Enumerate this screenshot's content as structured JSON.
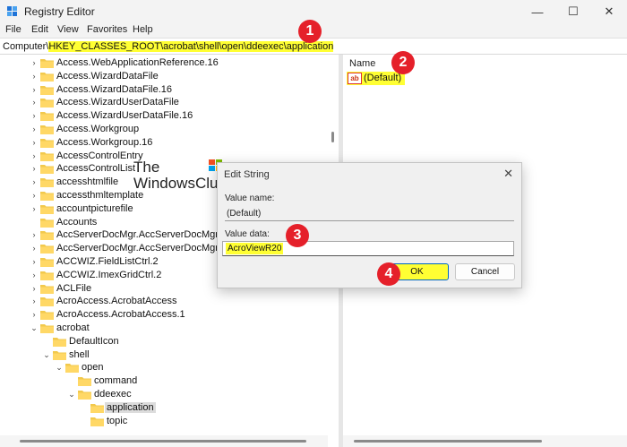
{
  "window": {
    "title": "Registry Editor",
    "minimize": "—",
    "maximize": "☐",
    "close": "✕"
  },
  "menu": [
    "File",
    "Edit",
    "View",
    "Favorites",
    "Help"
  ],
  "address": {
    "prefix": "Computer\\",
    "path": "HKEY_CLASSES_ROOT\\acrobat\\shell\\open\\ddeexec\\application"
  },
  "tree": [
    {
      "label": "Access.WebApplicationReference.16",
      "level": 0,
      "chevron": "›"
    },
    {
      "label": "Access.WizardDataFile",
      "level": 0,
      "chevron": "›"
    },
    {
      "label": "Access.WizardDataFile.16",
      "level": 0,
      "chevron": "›"
    },
    {
      "label": "Access.WizardUserDataFile",
      "level": 0,
      "chevron": "›"
    },
    {
      "label": "Access.WizardUserDataFile.16",
      "level": 0,
      "chevron": "›"
    },
    {
      "label": "Access.Workgroup",
      "level": 0,
      "chevron": "›"
    },
    {
      "label": "Access.Workgroup.16",
      "level": 0,
      "chevron": "›"
    },
    {
      "label": "AccessControlEntry",
      "level": 0,
      "chevron": "›"
    },
    {
      "label": "AccessControlList",
      "level": 0,
      "chevron": "›"
    },
    {
      "label": "accesshtmlfile",
      "level": 0,
      "chevron": "›"
    },
    {
      "label": "accessthmltemplate",
      "level": 0,
      "chevron": "›"
    },
    {
      "label": "accountpicturefile",
      "level": 0,
      "chevron": "›"
    },
    {
      "label": "Accounts",
      "level": 0,
      "chevron": ""
    },
    {
      "label": "AccServerDocMgr.AccServerDocMgr",
      "level": 0,
      "chevron": "›"
    },
    {
      "label": "AccServerDocMgr.AccServerDocMgr.1",
      "level": 0,
      "chevron": "›"
    },
    {
      "label": "ACCWIZ.FieldListCtrl.2",
      "level": 0,
      "chevron": "›"
    },
    {
      "label": "ACCWIZ.ImexGridCtrl.2",
      "level": 0,
      "chevron": "›"
    },
    {
      "label": "ACLFile",
      "level": 0,
      "chevron": "›"
    },
    {
      "label": "AcroAccess.AcrobatAccess",
      "level": 0,
      "chevron": "›"
    },
    {
      "label": "AcroAccess.AcrobatAccess.1",
      "level": 0,
      "chevron": "›"
    },
    {
      "label": "acrobat",
      "level": 0,
      "chevron": "⌄"
    },
    {
      "label": "DefaultIcon",
      "level": 1,
      "chevron": ""
    },
    {
      "label": "shell",
      "level": 1,
      "chevron": "⌄"
    },
    {
      "label": "open",
      "level": 2,
      "chevron": "⌄"
    },
    {
      "label": "command",
      "level": 3,
      "chevron": ""
    },
    {
      "label": "ddeexec",
      "level": 3,
      "chevron": "⌄"
    },
    {
      "label": "application",
      "level": 4,
      "chevron": "",
      "selected": true
    },
    {
      "label": "topic",
      "level": 4,
      "chevron": ""
    }
  ],
  "right_pane": {
    "column_header": "Name",
    "value_icon": "ab",
    "value_name": "(Default)"
  },
  "watermark": {
    "line1": "The",
    "line2": "WindowsClub"
  },
  "dialog": {
    "title": "Edit String",
    "close": "✕",
    "value_name_label": "Value name:",
    "value_name": "(Default)",
    "value_data_label": "Value data:",
    "value_data": "AcroViewR20",
    "ok_label": "OK",
    "cancel_label": "Cancel"
  },
  "markers": [
    "1",
    "2",
    "3",
    "4"
  ],
  "colors": {
    "highlight": "#ffff33",
    "marker": "#e5202a",
    "folder": "#f2c94c",
    "accent": "#0067c0"
  }
}
